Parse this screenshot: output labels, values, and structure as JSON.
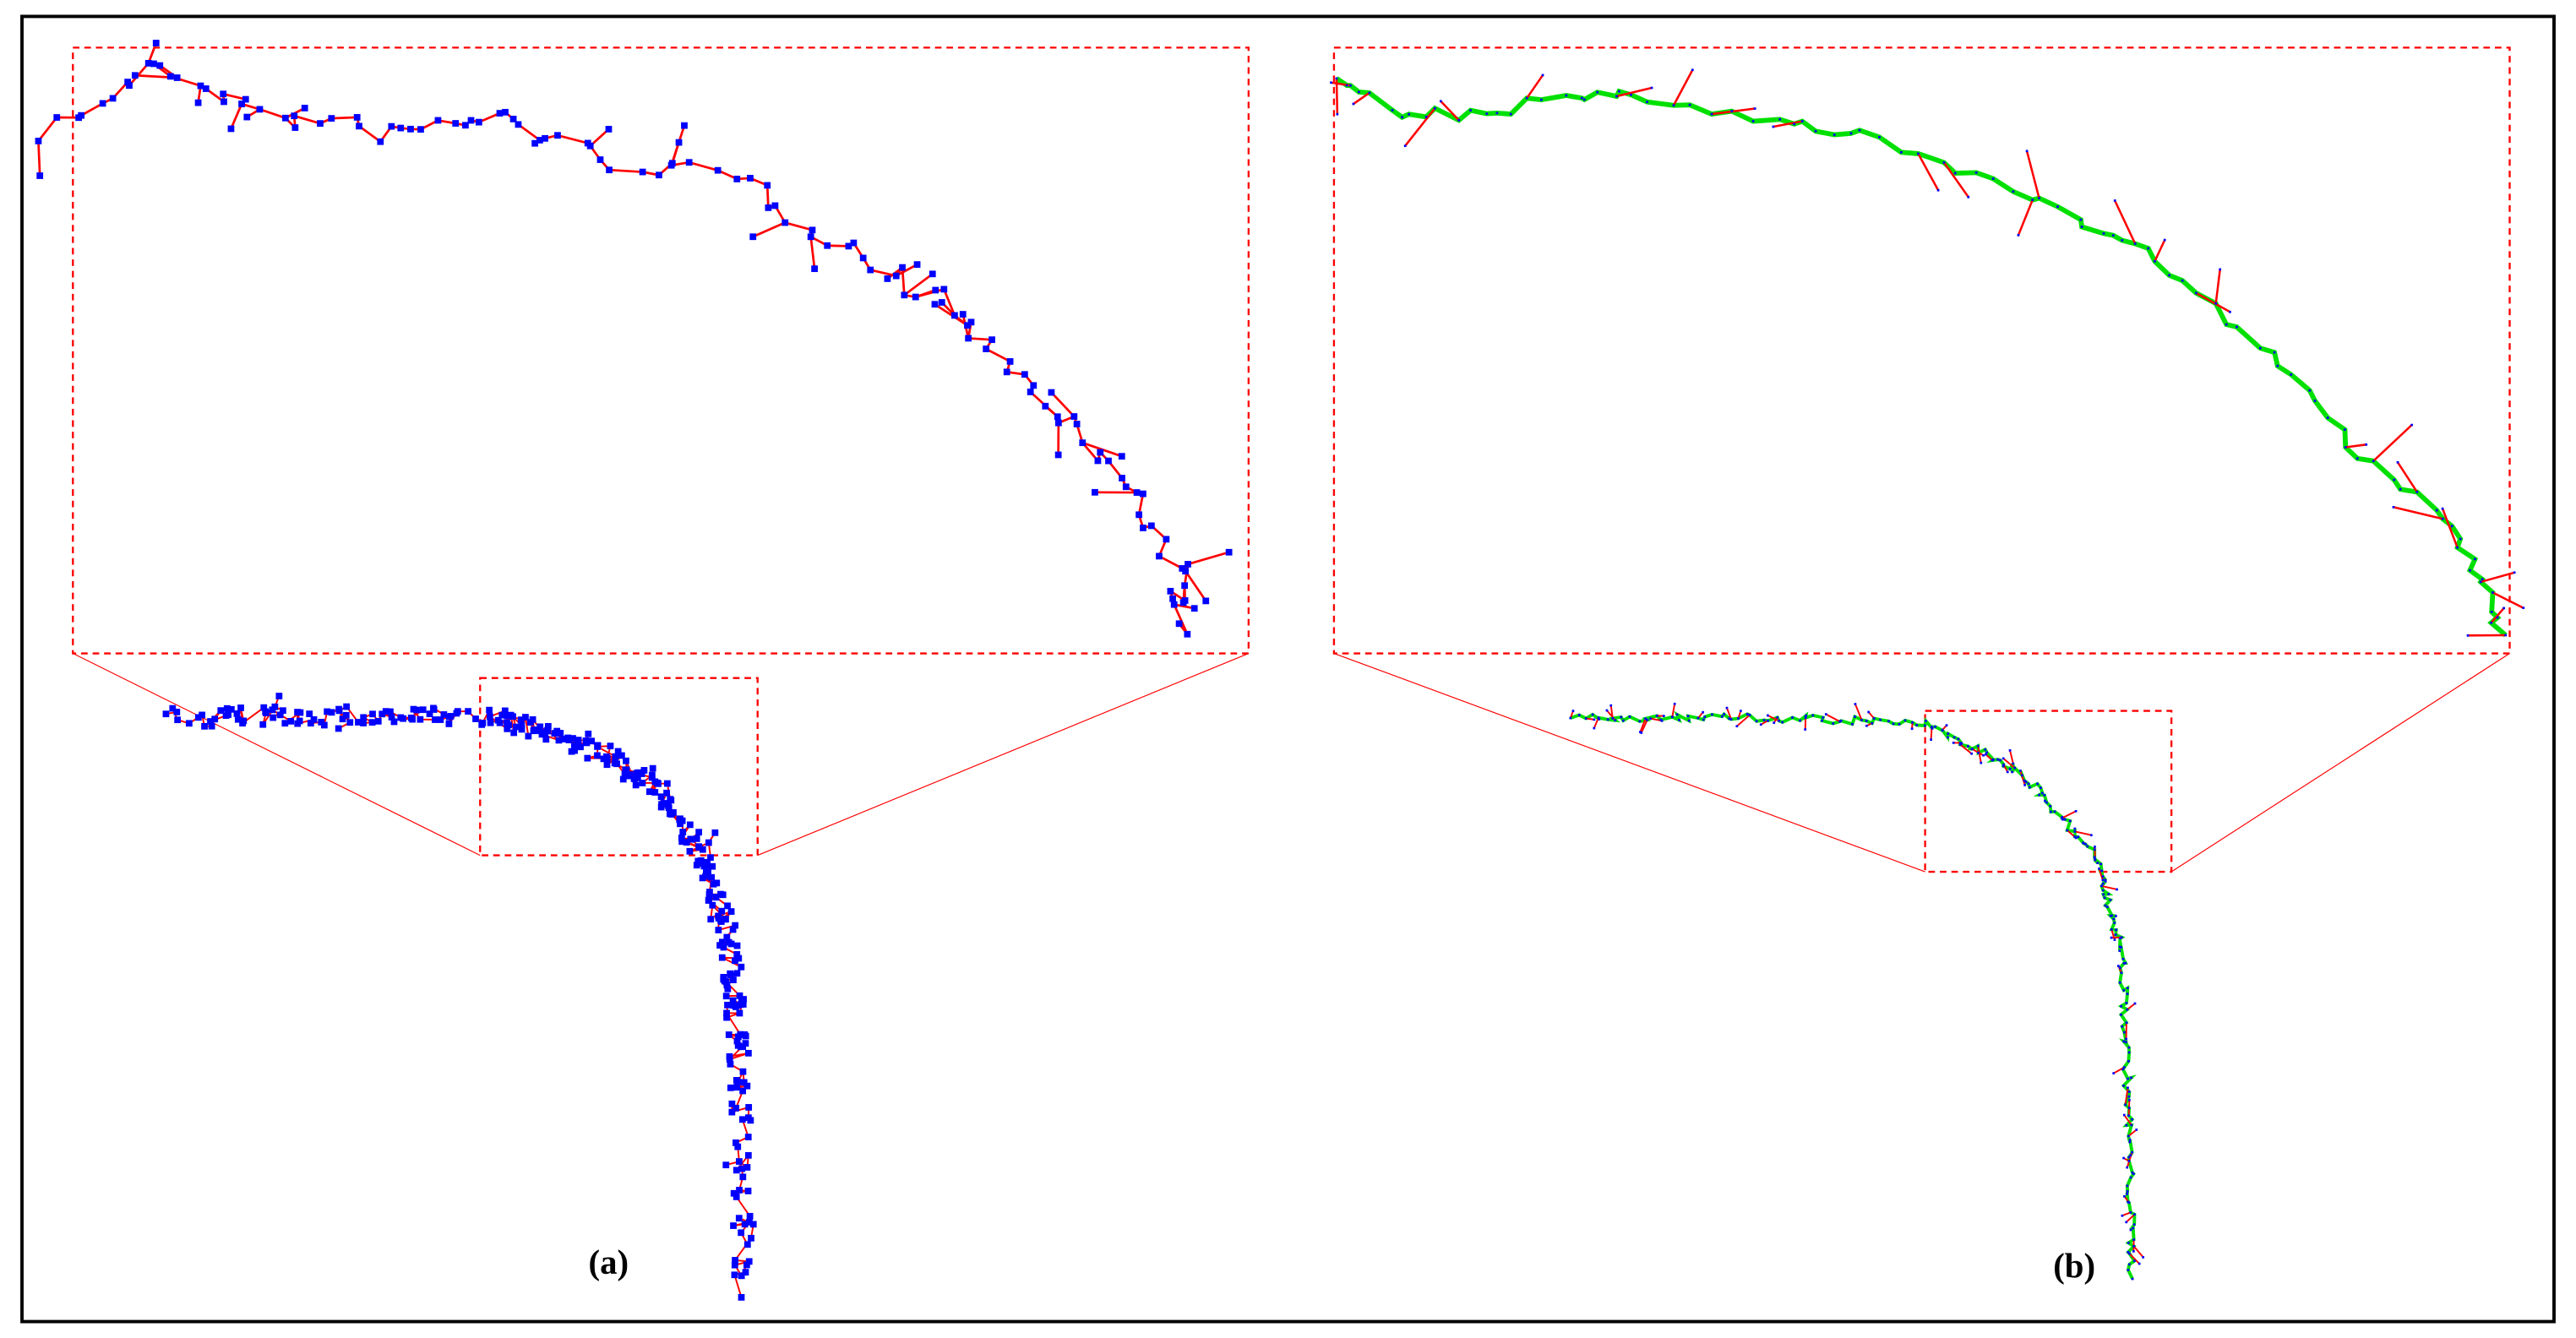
{
  "panels": [
    {
      "label": "(a)",
      "branch_color": "#ff0000",
      "point_color": "#0000ff"
    },
    {
      "label": "(b)",
      "trunk_color": "#00e000",
      "branch_color": "#ff0000",
      "point_color": "#0000ff"
    }
  ],
  "colors": {
    "frame": "#000000",
    "zoom_box": "#ff0000"
  }
}
